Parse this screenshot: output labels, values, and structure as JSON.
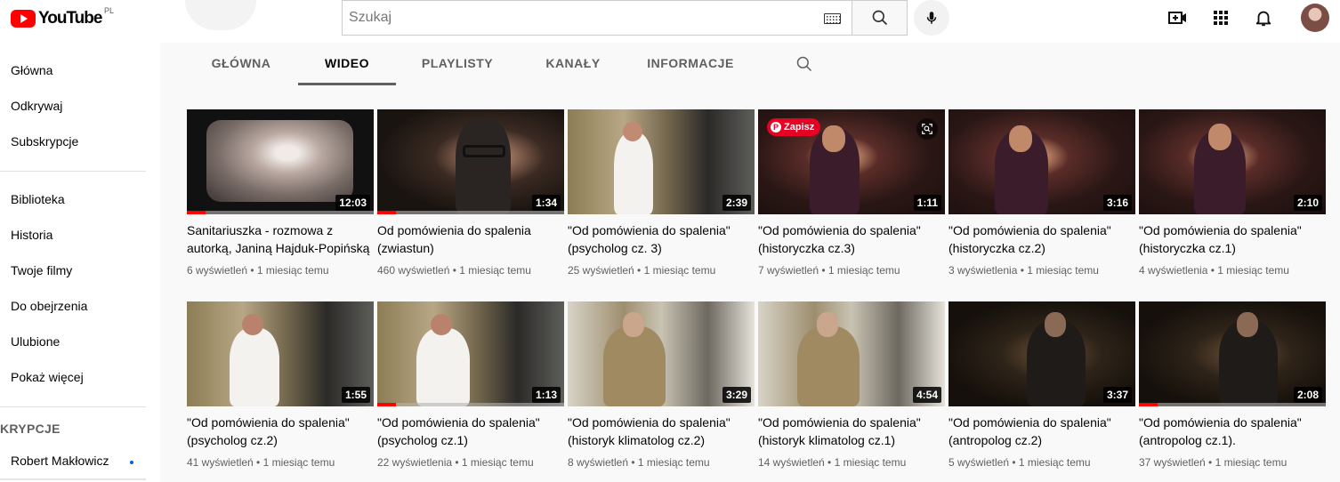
{
  "header": {
    "logo_text": "YouTube",
    "country_code": "PL",
    "search_placeholder": "Szukaj"
  },
  "sidebar": {
    "items_top": [
      "Główna",
      "Odkrywaj",
      "Subskrypcje"
    ],
    "items_library": [
      "Biblioteka",
      "Historia",
      "Twoje filmy",
      "Do obejrzenia",
      "Ulubione",
      "Pokaż więcej"
    ],
    "section_title": "KRYPCJE",
    "subscriptions": [
      "Robert Makłowicz"
    ]
  },
  "tabs": [
    {
      "label": "GŁÓWNA",
      "active": false
    },
    {
      "label": "WIDEO",
      "active": true
    },
    {
      "label": "PLAYLISTY",
      "active": false
    },
    {
      "label": "KANAŁY",
      "active": false
    },
    {
      "label": "INFORMACJE",
      "active": false
    }
  ],
  "overlay": {
    "pin_label": "Zapisz"
  },
  "videos": [
    {
      "title": "Sanitariuszka - rozmowa z autorką, Janiną Hajduk-Popińską",
      "views": "6 wyświetleń",
      "age": "1 miesiąc temu",
      "duration": "12:03",
      "progress": 0.1
    },
    {
      "title": "Od pomówienia do spalenia (zwiastun)",
      "views": "460 wyświetleń",
      "age": "1 miesiąc temu",
      "duration": "1:34",
      "progress": 0.1
    },
    {
      "title": "\"Od pomówienia do spalenia\" (psycholog cz. 3)",
      "views": "25 wyświetleń",
      "age": "1 miesiąc temu",
      "duration": "2:39",
      "progress": 0
    },
    {
      "title": "\"Od pomówienia do spalenia\" (historyczka cz.3)",
      "views": "7 wyświetleń",
      "age": "1 miesiąc temu",
      "duration": "1:11",
      "progress": 0
    },
    {
      "title": "\"Od pomówienia do spalenia\" (historyczka cz.2)",
      "views": "3 wyświetlenia",
      "age": "1 miesiąc temu",
      "duration": "3:16",
      "progress": 0
    },
    {
      "title": "\"Od pomówienia do spalenia\" (historyczka cz.1)",
      "views": "4 wyświetlenia",
      "age": "1 miesiąc temu",
      "duration": "2:10",
      "progress": 0
    },
    {
      "title": "\"Od pomówienia do spalenia\" (psycholog cz.2)",
      "views": "41 wyświetleń",
      "age": "1 miesiąc temu",
      "duration": "1:55",
      "progress": 0
    },
    {
      "title": "\"Od pomówienia do spalenia\" (psycholog cz.1)",
      "views": "22 wyświetlenia",
      "age": "1 miesiąc temu",
      "duration": "1:13",
      "progress": 0.1
    },
    {
      "title": "\"Od pomówienia do spalenia\" (historyk klimatolog cz.2)",
      "views": "8 wyświetleń",
      "age": "1 miesiąc temu",
      "duration": "3:29",
      "progress": 0
    },
    {
      "title": "\"Od pomówienia do spalenia\" (historyk klimatolog cz.1)",
      "views": "14 wyświetleń",
      "age": "1 miesiąc temu",
      "duration": "4:54",
      "progress": 0
    },
    {
      "title": "\"Od pomówienia do spalenia\" (antropolog cz.2)",
      "views": "5 wyświetleń",
      "age": "1 miesiąc temu",
      "duration": "3:37",
      "progress": 0
    },
    {
      "title": "\"Od pomówienia do spalenia\" (antropolog cz.1).",
      "views": "37 wyświetleń",
      "age": "1 miesiąc temu",
      "duration": "2:08",
      "progress": 0.1
    }
  ],
  "colors": {
    "brand_red": "#ff0000",
    "pinterest_red": "#e60023",
    "text_primary": "#030303",
    "text_secondary": "#606060",
    "accent_blue": "#065fd4"
  }
}
